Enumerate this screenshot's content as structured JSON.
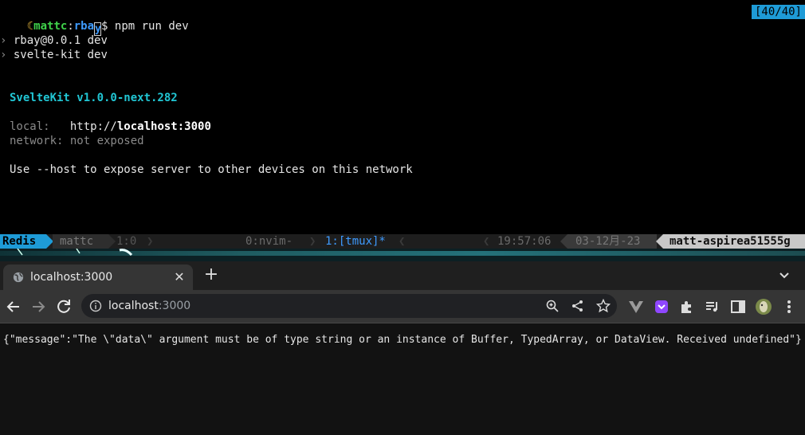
{
  "terminal": {
    "prompt_user": "mattc",
    "prompt_sep": ":",
    "prompt_dir": "rba",
    "prompt_dir_cursor": "y",
    "prompt_symbol": "$",
    "command": " npm run dev",
    "pane_counter": "[40/40]",
    "script_line1": " rbay@0.0.1 dev",
    "script_line2": " svelte-kit dev",
    "svelte_banner": "SvelteKit v1.0.0-next.282",
    "local_label": "local:   ",
    "local_url_prefix": "http://",
    "local_url_host": "localhost:3000",
    "network_label": "network: ",
    "network_value": "not exposed",
    "hint": "Use --host to expose server to other devices on this network"
  },
  "tmux": {
    "session": "Redis",
    "user": "mattc",
    "position": "1:0",
    "window0": "0:nvim-",
    "window1": "1:[tmux]*",
    "time": "19:57:06",
    "date": "03-12月-23",
    "host": "matt-aspirea51555g"
  },
  "browser": {
    "tab_title": "localhost:3000",
    "url_host": "localhost",
    "url_port": ":3000",
    "page_body": "{\"message\":\"The \\\"data\\\" argument must be of type string or an instance of Buffer, TypedArray, or DataView. Received undefined\"}"
  },
  "icons": {
    "back": "arrow-left-icon",
    "forward": "arrow-right-icon",
    "reload": "reload-icon",
    "info": "info-icon",
    "zoom": "zoom-icon",
    "share": "share-icon",
    "bookmark": "star-icon"
  },
  "colors": {
    "accent": "#1e9bd7",
    "terminal_green": "#3fd14a",
    "terminal_blue": "#3e9bff",
    "svelte_cyan": "#21c6d4"
  }
}
